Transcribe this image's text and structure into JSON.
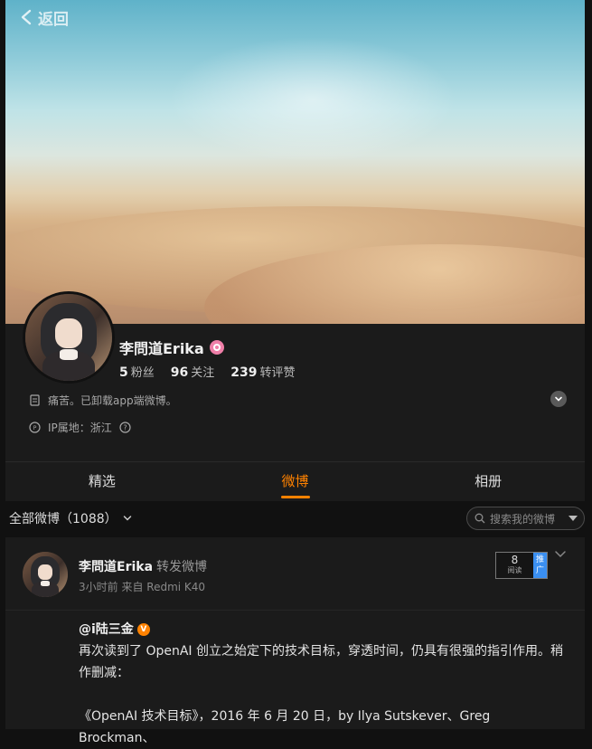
{
  "nav": {
    "back_label": "返回"
  },
  "profile": {
    "name": "李問道Erika",
    "stats": [
      {
        "value": "5",
        "label": "粉丝"
      },
      {
        "value": "96",
        "label": "关注"
      },
      {
        "value": "239",
        "label": "转评赞"
      }
    ],
    "bio": "痛苦。已卸载app端微博。",
    "ip_location": "IP属地：浙江"
  },
  "tabs": [
    {
      "label": "精选",
      "active": false
    },
    {
      "label": "微博",
      "active": true
    },
    {
      "label": "相册",
      "active": false
    }
  ],
  "filter": {
    "all_label": "全部微博（1088）",
    "search_placeholder": "搜索我的微博"
  },
  "post": {
    "author": "李問道Erika",
    "action": "转发微博",
    "meta": "3小时前  来自 Redmi K40",
    "read_count": "8",
    "read_label": "阅读",
    "promo_label": "推广",
    "mention": "@i陆三金",
    "mention_badge": "V",
    "text": "再次读到了 OpenAI 创立之始定下的技术目标，穿透时间，仍具有很强的指引作用。稍作删减：",
    "quote": "《OpenAI 技术目标》，2016 年 6 月 20 日，by Ilya Sutskever、Greg Brockman、"
  },
  "colors": {
    "accent": "#ff8200",
    "background": "#111111",
    "panel": "#1b1b1b",
    "promo": "#3a8ff1"
  }
}
